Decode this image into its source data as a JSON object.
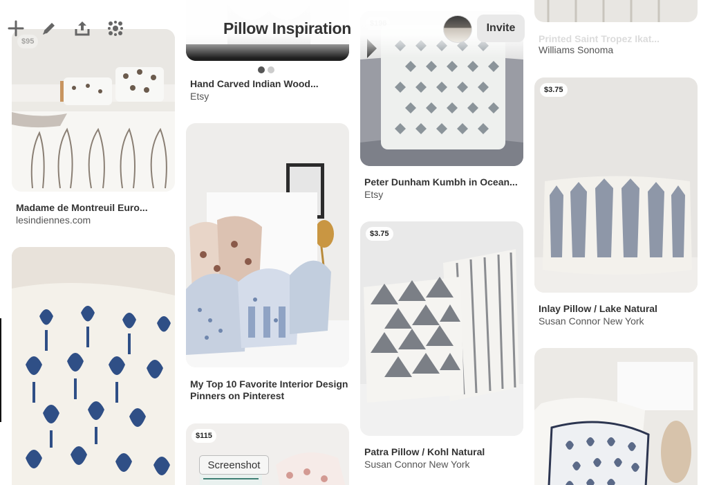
{
  "toolbar": {
    "icons": [
      "plus-icon",
      "pencil-icon",
      "share-icon",
      "organize-icon"
    ]
  },
  "header": {
    "title": "Pillow Inspiration",
    "invite_label": "Invite"
  },
  "pins": {
    "madame": {
      "price": "$95",
      "title": "Madame de Montreuil Euro...",
      "source": "lesindiennes.com"
    },
    "hand_carved": {
      "title": "Hand Carved Indian Wood...",
      "source": "Etsy"
    },
    "top10": {
      "title_line1": "My Top 10 Favorite Interior Design",
      "title_line2": "Pinners on Pinterest"
    },
    "price115": {
      "price": "$115"
    },
    "peter": {
      "price": "$196",
      "title": "Peter Dunham Kumbh in Ocean...",
      "source": "Etsy"
    },
    "patra": {
      "price": "$3.75",
      "title": "Patra Pillow / Kohl Natural",
      "source": "Susan Connor New York"
    },
    "printed": {
      "title": "Printed Saint Tropez Ikat...",
      "source": "Williams Sonoma"
    },
    "inlay": {
      "price": "$3.75",
      "title": "Inlay Pillow / Lake Natural",
      "source": "Susan Connor New York"
    }
  },
  "overlay": {
    "screenshot_label": "Screenshot"
  },
  "colors": {
    "accent_dark": "#333333",
    "invite_bg": "#e9e9e9",
    "pattern_blue": "#2f4f86",
    "pattern_grey": "#7a808a"
  }
}
